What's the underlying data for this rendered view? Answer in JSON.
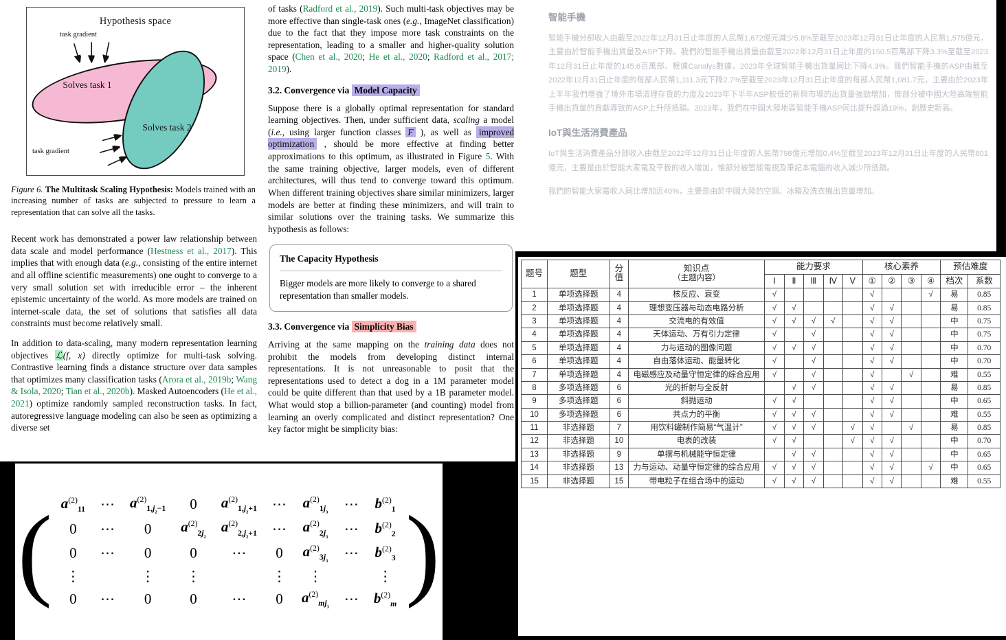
{
  "paper": {
    "figure": {
      "box_title": "Hypothesis space",
      "label_task1": "Solves task 1",
      "label_task2": "Solves task 2",
      "gradient_label_top": "task gradient",
      "gradient_label_bottom": "task gradient",
      "caption_prefix": "Figure 6.",
      "caption_bold": "The Multitask Scaling Hypothesis:",
      "caption_body": " Models trained with an increasing number of tasks are subjected to pressure to learn a representation that can solve all the tasks."
    },
    "left_paragraphs": [
      "Recent work has demonstrated a power law relationship between data scale and model performance (Hestness et al., 2017). This implies that with enough data (e.g., consisting of the entire internet and all offline scientific measurements) one ought to converge to a very small solution set with irreducible error – the inherent epistemic uncertainty of the world. As more models are trained on internet-scale data, the set of solutions that satisfies all data constraints must become relatively small.",
      "In addition to data-scaling, many modern representation learning objectives L(f, x) directly optimize for multi-task solving. Contrastive learning finds a distance structure over data samples that optimizes many classification tasks (Arora et al., 2019b; Wang & Isola, 2020; Tian et al., 2020b). Masked Autoencoders (He et al., 2021) optimize randomly sampled reconstruction tasks. In fact, autoregressive language modeling can also be seen as optimizing a diverse set"
    ],
    "mid_intro": "of tasks (Radford et al., 2019). Such multi-task objectives may be more effective than single-task ones (e.g., ImageNet classification) due to the fact that they impose more task constraints on the representation, leading to a smaller and higher-quality solution space (Chen et al., 2020; He et al., 2020; Radford et al., 2017; 2019).",
    "section_3_2": {
      "number": "3.2. Convergence via",
      "highlight": "Model Capacity",
      "body": "Suppose there is a globally optimal representation for standard learning objectives. Then, under sufficient data, scaling a model (i.e., using larger function classes F ), as well as improved optimization , should be more effective at finding better approximations to this optimum, as illustrated in Figure 5. With the same training objective, larger models, even of different architectures, will thus tend to converge toward this optimum. When different training objectives share similar minimizers, larger models are better at finding these minimizers, and will train to similar solutions over the training tasks. We summarize this hypothesis as follows:",
      "inline_hl_f": "F",
      "inline_hl_opt": "improved optimization"
    },
    "capacity_box": {
      "title": "The Capacity Hypothesis",
      "body": "Bigger models are more likely to converge to a shared representation than smaller models."
    },
    "section_3_3": {
      "number": "3.3. Convergence via",
      "highlight": "Simplicity Bias",
      "body": "Arriving at the same mapping on the training data does not prohibit the models from developing distinct internal representations. It is not unreasonable to posit that the representations used to detect a dog in a 1M parameter model could be quite different than that used by a 1B parameter model. What would stop a billion-parameter (and counting) model from learning an overly complicated and distinct representation? One key factor might be simplicity bias:"
    },
    "citations": {
      "hestness": "Hestness et al., 2017",
      "arora": "Arora et al., 2019b",
      "wang": "Wang & Isola, 2020",
      "tian": "Tian et al., 2020b",
      "he2021": "He et al., 2021",
      "radford2019": "Radford et al., 2019",
      "chen2020": "Chen et al., 2020",
      "he2020": "He et al., 2020",
      "radford2017": "Radford et al., 2017; 2019",
      "figure5": "5"
    }
  },
  "matrix": {
    "rows": [
      [
        "a_11^(2)",
        "⋯",
        "a_{1,j_2-1}^(2)",
        "0",
        "a_{1,j_2+1}^(2)",
        "⋯",
        "a_{1j_3}^(2)",
        "⋯",
        "b_1^(2)"
      ],
      [
        "0",
        "⋯",
        "0",
        "a_{2j_2}^(2)",
        "a_{2,j_2+1}^(2)",
        "⋯",
        "a_{2j_3}^(2)",
        "⋯",
        "b_2^(2)"
      ],
      [
        "0",
        "⋯",
        "0",
        "0",
        "⋯",
        "0",
        "a_{3j_3}^(2)",
        "⋯",
        "b_3^(2)"
      ],
      [
        "⋮",
        "",
        "⋮",
        "⋮",
        "",
        "⋮",
        "⋮",
        "",
        "⋮"
      ],
      [
        "0",
        "⋯",
        "0",
        "0",
        "⋯",
        "0",
        "a_{mj_3}^(2)",
        "⋯",
        "b_m^(2)"
      ]
    ]
  },
  "cn_report": {
    "section1_title": "智能手機",
    "section1_body": "智能手機分部收入由截至2022年12月31日止年度的人民幣1,672億元減少5.8%至截至2023年12月31日止年度的人民幣1,575億元，主要由於智能手機出貨量及ASP下降。我們的智能手機出貨量由截至2022年12月31日止年度的150.5百萬部下降3.3%至截至2023年12月31日止年度的145.6百萬部。根據Canalys數據，2023年全球智能手機出貨量同比下降4.3%。我們智能手機的ASP由截至2022年12月31日止年度的每部人民幣1,111.3元下降2.7%至截至2023年12月31日止年度的每部人民幣1,081.7元，主要由於2023年上半年我們增強了境外市場清理存貨的力度及2023年下半年ASP較低的新興市場的出貨量強勁增加，惟部分被中國大陸高端智能手機出貨量的貢獻導致的ASP上升所抵銷。2023年，我們在中國大陸地區智能手機ASP同比提升超過19%，創歷史新高。",
    "section2_title": "IoT與生活消費產品",
    "section2_body": "IoT與生活消費產品分部收入由截至2022年12月31日止年度的人民幣798億元增加0.4%至截至2023年12月31日止年度的人民幣801億元，主要是由於智能大家電及平板的收入增加，惟部分被智能電視及筆記本電腦的收入減少所抵銷。",
    "section2_extra": "我們的智能大家電收入同比增加近40%，主要是由於中國大陸的空調、冰箱及洗衣機出貨量增加。"
  },
  "exam_table": {
    "headers": {
      "no": "题号",
      "type": "题型",
      "score_top": "分",
      "score_bottom": "值",
      "kp_top": "知识点",
      "kp_bottom": "（主题内容）",
      "ability": "能力要求",
      "core": "核心素养",
      "difficulty": "预估难度",
      "ability_cols": [
        "Ⅰ",
        "Ⅱ",
        "Ⅲ",
        "Ⅳ",
        "Ⅴ"
      ],
      "core_cols": [
        "①",
        "②",
        "③",
        "④"
      ],
      "diff_level": "档次",
      "diff_coef": "系数"
    },
    "check_mark": "√",
    "rows": [
      {
        "no": "1",
        "type": "单项选择题",
        "score": "4",
        "kp": "核反应、衰变",
        "ability": [
          1,
          0,
          0,
          0,
          0
        ],
        "core": [
          1,
          0,
          0,
          1
        ],
        "level": "易",
        "coef": "0.85"
      },
      {
        "no": "2",
        "type": "单项选择题",
        "score": "4",
        "kp": "理想变压器与动态电路分析",
        "ability": [
          1,
          1,
          0,
          0,
          0
        ],
        "core": [
          1,
          1,
          0,
          0
        ],
        "level": "易",
        "coef": "0.85"
      },
      {
        "no": "3",
        "type": "单项选择题",
        "score": "4",
        "kp": "交流电的有效值",
        "ability": [
          1,
          1,
          1,
          1,
          0
        ],
        "core": [
          1,
          1,
          0,
          0
        ],
        "level": "中",
        "coef": "0.75"
      },
      {
        "no": "4",
        "type": "单项选择题",
        "score": "4",
        "kp": "天体运动、万有引力定律",
        "ability": [
          1,
          0,
          1,
          0,
          0
        ],
        "core": [
          1,
          1,
          0,
          0
        ],
        "level": "中",
        "coef": "0.75"
      },
      {
        "no": "5",
        "type": "单项选择题",
        "score": "4",
        "kp": "力与运动的图像问题",
        "ability": [
          1,
          1,
          1,
          0,
          0
        ],
        "core": [
          1,
          1,
          0,
          0
        ],
        "level": "中",
        "coef": "0.70"
      },
      {
        "no": "6",
        "type": "单项选择题",
        "score": "4",
        "kp": "自由落体运动、能量转化",
        "ability": [
          1,
          0,
          1,
          0,
          0
        ],
        "core": [
          1,
          1,
          0,
          0
        ],
        "level": "中",
        "coef": "0.70"
      },
      {
        "no": "7",
        "type": "单项选择题",
        "score": "4",
        "kp": "电磁感应及动量守恒定律的综合应用",
        "ability": [
          1,
          0,
          1,
          0,
          0
        ],
        "core": [
          1,
          0,
          1,
          0
        ],
        "level": "难",
        "coef": "0.55"
      },
      {
        "no": "8",
        "type": "多项选择题",
        "score": "6",
        "kp": "光的折射与全反射",
        "ability": [
          0,
          1,
          1,
          0,
          0
        ],
        "core": [
          1,
          1,
          0,
          0
        ],
        "level": "易",
        "coef": "0.85"
      },
      {
        "no": "9",
        "type": "多项选择题",
        "score": "6",
        "kp": "斜抛运动",
        "ability": [
          1,
          1,
          0,
          0,
          0
        ],
        "core": [
          1,
          1,
          0,
          0
        ],
        "level": "中",
        "coef": "0.65"
      },
      {
        "no": "10",
        "type": "多项选择题",
        "score": "6",
        "kp": "共点力的平衡",
        "ability": [
          1,
          1,
          1,
          0,
          0
        ],
        "core": [
          1,
          1,
          0,
          0
        ],
        "level": "难",
        "coef": "0.55"
      },
      {
        "no": "11",
        "type": "非选择题",
        "score": "7",
        "kp": "用饮料罐制作简易“气温计”",
        "ability": [
          1,
          1,
          1,
          0,
          1
        ],
        "core": [
          1,
          0,
          1,
          0
        ],
        "level": "易",
        "coef": "0.85"
      },
      {
        "no": "12",
        "type": "非选择题",
        "score": "10",
        "kp": "电表的改装",
        "ability": [
          1,
          1,
          0,
          0,
          1
        ],
        "core": [
          1,
          1,
          0,
          0
        ],
        "level": "中",
        "coef": "0.70"
      },
      {
        "no": "13",
        "type": "非选择题",
        "score": "9",
        "kp": "单摆与机械能守恒定律",
        "ability": [
          0,
          1,
          1,
          0,
          0
        ],
        "core": [
          1,
          1,
          0,
          0
        ],
        "level": "中",
        "coef": "0.65"
      },
      {
        "no": "14",
        "type": "非选择题",
        "score": "13",
        "kp": "力与运动、动量守恒定律的综合应用",
        "ability": [
          1,
          1,
          1,
          0,
          0
        ],
        "core": [
          1,
          1,
          0,
          1
        ],
        "level": "中",
        "coef": "0.65"
      },
      {
        "no": "15",
        "type": "非选择题",
        "score": "15",
        "kp": "带电粒子在组合场中的运动",
        "ability": [
          1,
          1,
          1,
          0,
          0
        ],
        "core": [
          1,
          1,
          0,
          0
        ],
        "level": "难",
        "coef": "0.55"
      }
    ]
  }
}
